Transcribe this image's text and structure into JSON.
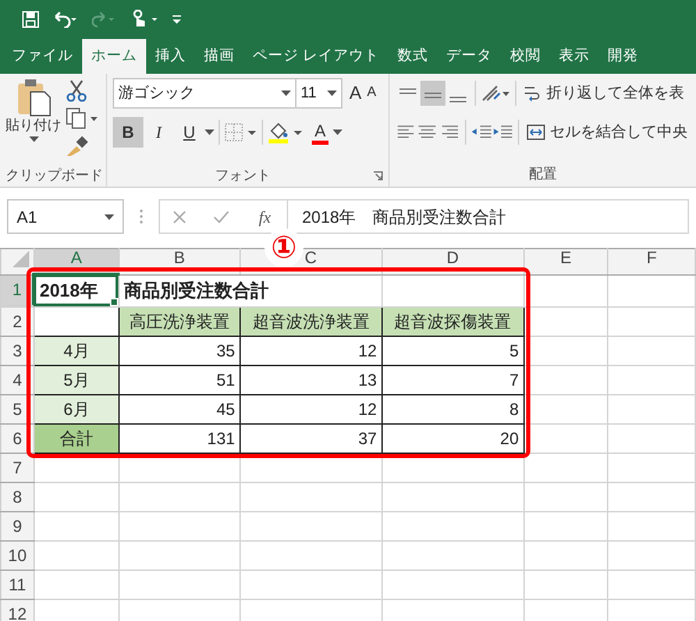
{
  "tabs": [
    {
      "label": "ファイル",
      "selected": false
    },
    {
      "label": "ホーム",
      "selected": true
    },
    {
      "label": "挿入",
      "selected": false
    },
    {
      "label": "描画",
      "selected": false
    },
    {
      "label": "ページ レイアウト",
      "selected": false
    },
    {
      "label": "数式",
      "selected": false
    },
    {
      "label": "データ",
      "selected": false
    },
    {
      "label": "校閲",
      "selected": false
    },
    {
      "label": "表示",
      "selected": false
    },
    {
      "label": "開発",
      "selected": false
    }
  ],
  "ribbon": {
    "clipboard": {
      "paste_label": "貼り付け",
      "group_label": "クリップボード"
    },
    "font": {
      "font_name": "游ゴシック",
      "font_size": "11",
      "grow_label": "A",
      "shrink_label": "A",
      "font_color_label": "A",
      "group_label": "フォント",
      "styles": [
        {
          "label": "B",
          "selected": true
        },
        {
          "label": "I",
          "selected": false
        },
        {
          "label": "U",
          "selected": false
        }
      ]
    },
    "alignment": {
      "vertical": [
        {
          "selected": false
        },
        {
          "selected": true
        },
        {
          "selected": false
        }
      ],
      "wrap_text": "折り返して全体を表",
      "merge": "セルを結合して中央",
      "group_label": "配置"
    }
  },
  "formula_bar": {
    "name_box": "A1",
    "function_label": "fx",
    "formula": "2018年　商品別受注数合計"
  },
  "annotation": {
    "label": "①"
  },
  "sheet": {
    "columns": [
      {
        "label": "A",
        "selected": true
      },
      {
        "label": "B",
        "selected": false
      },
      {
        "label": "C",
        "selected": false
      },
      {
        "label": "D",
        "selected": false
      },
      {
        "label": "E",
        "selected": false
      },
      {
        "label": "F",
        "selected": false
      }
    ],
    "rows": [
      {
        "header": "1",
        "selected": true,
        "cells": [
          {
            "kind": "title",
            "text": "2018年",
            "selected": true
          },
          {
            "kind": "title",
            "text": "商品別受注数合計",
            "selected": false
          }
        ]
      },
      {
        "header": "2",
        "selected": false,
        "cells": [
          {
            "kind": "blank",
            "selected": false
          },
          {
            "kind": "header",
            "text": "高圧洗浄装置",
            "color": "#c6e0b4",
            "selected": false
          },
          {
            "kind": "header",
            "text": "超音波洗浄装置",
            "color": "#c6e0b4",
            "selected": false
          },
          {
            "kind": "header",
            "text": "超音波探傷装置",
            "color": "#c6e0b4",
            "selected": false
          }
        ]
      },
      {
        "header": "3",
        "selected": false,
        "cells": [
          {
            "kind": "label",
            "text": "4月",
            "color": "#e2efda",
            "selected": false
          },
          {
            "kind": "number",
            "text": "35",
            "selected": false
          },
          {
            "kind": "number",
            "text": "12",
            "selected": false
          },
          {
            "kind": "number",
            "text": "5",
            "selected": false
          }
        ]
      },
      {
        "header": "4",
        "selected": false,
        "cells": [
          {
            "kind": "label",
            "text": "5月",
            "color": "#e2efda",
            "selected": false
          },
          {
            "kind": "number",
            "text": "51",
            "selected": false
          },
          {
            "kind": "number",
            "text": "13",
            "selected": false
          },
          {
            "kind": "number",
            "text": "7",
            "selected": false
          }
        ]
      },
      {
        "header": "5",
        "selected": false,
        "cells": [
          {
            "kind": "label",
            "text": "6月",
            "color": "#e2efda",
            "selected": false
          },
          {
            "kind": "number",
            "text": "45",
            "selected": false
          },
          {
            "kind": "number",
            "text": "12",
            "selected": false
          },
          {
            "kind": "number",
            "text": "8",
            "selected": false
          }
        ]
      },
      {
        "header": "6",
        "selected": false,
        "cells": [
          {
            "kind": "label",
            "text": "合計",
            "color": "#a9d08e",
            "selected": false
          },
          {
            "kind": "number",
            "text": "131",
            "selected": false
          },
          {
            "kind": "number",
            "text": "37",
            "selected": false
          },
          {
            "kind": "number",
            "text": "20",
            "selected": false
          }
        ]
      },
      {
        "header": "7",
        "selected": false
      },
      {
        "header": "8",
        "selected": false
      },
      {
        "header": "9",
        "selected": false
      },
      {
        "header": "10",
        "selected": false
      },
      {
        "header": "11",
        "selected": false
      },
      {
        "header": "12",
        "selected": false
      }
    ]
  }
}
